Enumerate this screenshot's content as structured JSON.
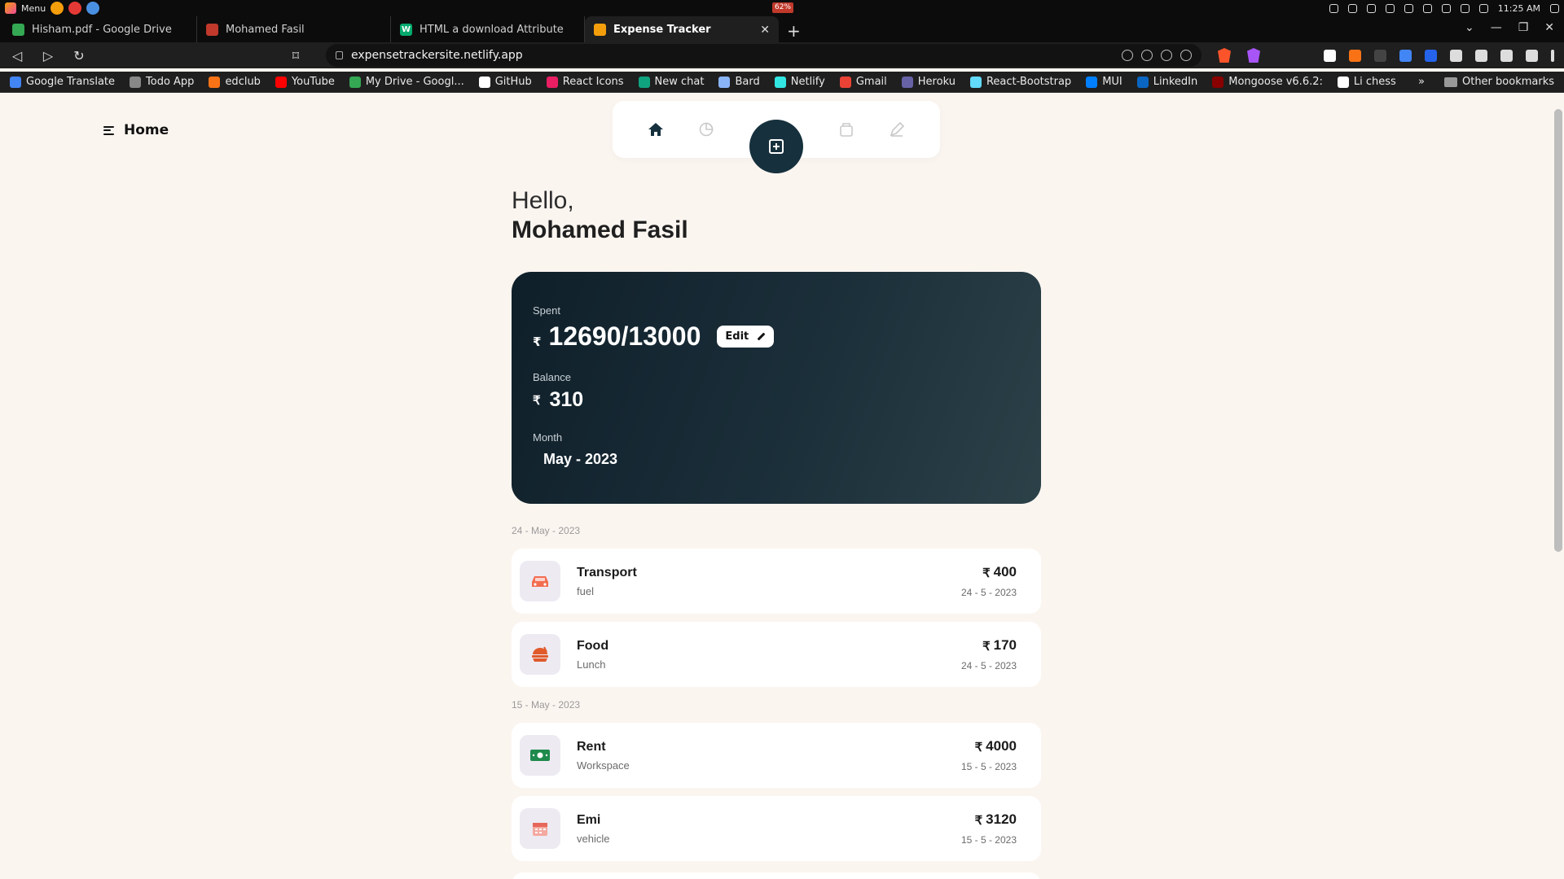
{
  "os": {
    "menu_label": "Menu",
    "battery": "62%",
    "clock": "11:25 AM"
  },
  "tabs": [
    {
      "title": "Hisham.pdf - Google Drive",
      "color": "#34a853"
    },
    {
      "title": "Mohamed Fasil",
      "color": "#c0392b"
    },
    {
      "title": "HTML a download Attribute",
      "color": "#04aa6d"
    },
    {
      "title": "Expense Tracker",
      "color": "#f59e0b"
    }
  ],
  "address_bar": {
    "url": "expensetrackersite.netlify.app"
  },
  "bookmarks": [
    {
      "label": "Google Translate",
      "color": "#4285f4"
    },
    {
      "label": "Todo App",
      "color": "#888888"
    },
    {
      "label": "edclub",
      "color": "#f97316"
    },
    {
      "label": "YouTube",
      "color": "#ff0000"
    },
    {
      "label": "My Drive - Googl...",
      "color": "#34a853"
    },
    {
      "label": "GitHub",
      "color": "#ffffff"
    },
    {
      "label": "React Icons",
      "color": "#e91e63"
    },
    {
      "label": "New chat",
      "color": "#10a37f"
    },
    {
      "label": "Bard",
      "color": "#8ab4f8"
    },
    {
      "label": "Netlify",
      "color": "#32e6e2"
    },
    {
      "label": "Gmail",
      "color": "#ea4335"
    },
    {
      "label": "Heroku",
      "color": "#6762a6"
    },
    {
      "label": "React-Bootstrap",
      "color": "#61dafb"
    },
    {
      "label": "MUI",
      "color": "#007fff"
    },
    {
      "label": "LinkedIn",
      "color": "#0a66c2"
    },
    {
      "label": "Mongoose v6.6.2:",
      "color": "#880000"
    },
    {
      "label": "Li chess",
      "color": "#ffffff"
    }
  ],
  "bookmarks_other": "Other bookmarks",
  "bookmarks_overflow": "»",
  "app": {
    "page_title": "Home",
    "greeting": "Hello,",
    "user_name": "Mohamed Fasil",
    "currency_symbol": "₹",
    "summary": {
      "spent_label": "Spent",
      "spent_value": "12690/13000",
      "edit_label": "Edit",
      "balance_label": "Balance",
      "balance_value": "310",
      "month_label": "Month",
      "month_value": "May - 2023"
    },
    "groups": [
      {
        "date": "24 - May - 2023",
        "items": [
          {
            "category": "Transport",
            "note": "fuel",
            "amount": "400",
            "date": "24 - 5 - 2023",
            "icon": "car-icon",
            "icon_color": "#f26d50"
          },
          {
            "category": "Food",
            "note": "Lunch",
            "amount": "170",
            "date": "24 - 5 - 2023",
            "icon": "food-icon",
            "icon_color": "#e05a2b"
          }
        ]
      },
      {
        "date": "15 - May - 2023",
        "items": [
          {
            "category": "Rent",
            "note": "Workspace",
            "amount": "4000",
            "date": "15 - 5 - 2023",
            "icon": "money-icon",
            "icon_color": "#1e8a4c"
          },
          {
            "category": "Emi",
            "note": "vehicle",
            "amount": "3120",
            "date": "15 - 5 - 2023",
            "icon": "calendar-icon",
            "icon_color": "#e6675a"
          }
        ]
      }
    ],
    "colors": {
      "card_dark": "#0f1f29",
      "fab": "#16303d",
      "background": "#fbf5f0"
    }
  }
}
